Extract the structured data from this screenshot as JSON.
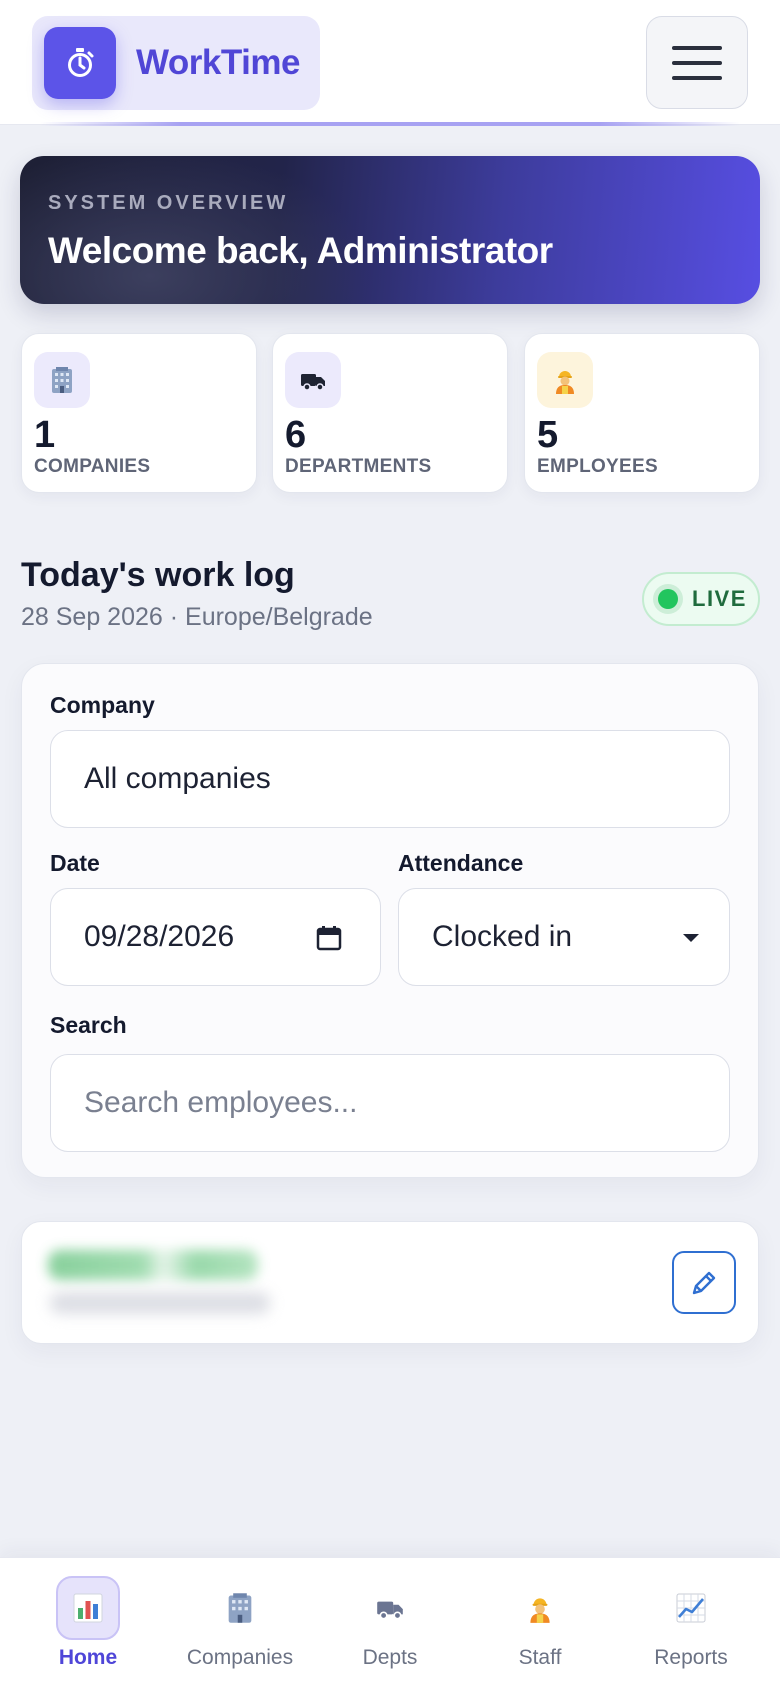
{
  "app": {
    "name": "WorkTime",
    "brand_icon": "stopwatch-icon",
    "accent": "#5c54e8"
  },
  "header": {
    "menu_icon": "hamburger-menu-icon"
  },
  "hero": {
    "kicker": "SYSTEM OVERVIEW",
    "title": "Welcome back, Administrator"
  },
  "stats": [
    {
      "icon": "office-building-icon",
      "value": "1",
      "label": "COMPANIES"
    },
    {
      "icon": "truck-icon",
      "value": "6",
      "label": "DEPARTMENTS"
    },
    {
      "icon": "construction-worker-icon",
      "value": "5",
      "label": "EMPLOYEES"
    }
  ],
  "worklog": {
    "title": "Today's work log",
    "subtitle": "28 Sep 2026 · Europe/Belgrade",
    "status": "LIVE",
    "status_color": "#22c55e"
  },
  "filters": {
    "company_label": "Company",
    "company_value": "All companies",
    "date_label": "Date",
    "date_value": "09/28/2026",
    "attendance_label": "Attendance",
    "attendance_value": "Clocked in",
    "search_label": "Search",
    "search_placeholder": "Search employees..."
  },
  "record": {
    "edit_icon": "pencil-icon"
  },
  "nav": [
    {
      "icon": "bar-chart-icon",
      "label": "Home",
      "active": true
    },
    {
      "icon": "office-building-icon",
      "label": "Companies",
      "active": false
    },
    {
      "icon": "truck-icon",
      "label": "Depts",
      "active": false
    },
    {
      "icon": "construction-worker-icon",
      "label": "Staff",
      "active": false
    },
    {
      "icon": "trend-chart-icon",
      "label": "Reports",
      "active": false
    }
  ]
}
